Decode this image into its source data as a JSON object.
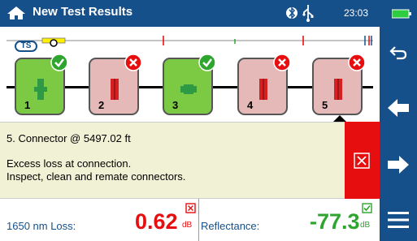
{
  "header": {
    "title": "New Test Results",
    "time": "23:03"
  },
  "sidebar": {
    "buttons": [
      "back-icon",
      "arrow-left-icon",
      "arrow-right-icon",
      "menu-icon"
    ]
  },
  "trace": {
    "ts_label": "TS"
  },
  "events": [
    {
      "number": "1",
      "status": "pass",
      "type": "splice"
    },
    {
      "number": "2",
      "status": "fail",
      "type": "connector"
    },
    {
      "number": "3",
      "status": "pass",
      "type": "splice"
    },
    {
      "number": "4",
      "status": "fail",
      "type": "connector"
    },
    {
      "number": "5",
      "status": "fail",
      "type": "connector"
    }
  ],
  "detail": {
    "title": "5. Connector @ 5497.02 ft",
    "line1": "Excess loss at connection.",
    "line2": "Inspect, clean and remate connectors."
  },
  "metrics": {
    "loss_label": "1650 nm Loss:",
    "loss_value": "0.62",
    "loss_unit": "dB",
    "refl_label": "Reflectance:",
    "refl_value": "-77.3",
    "refl_unit": "dB"
  },
  "colors": {
    "header": "#16508b",
    "pass": "#7cc943",
    "fail": "#e60e0e",
    "pass_text": "#2ea52e"
  }
}
